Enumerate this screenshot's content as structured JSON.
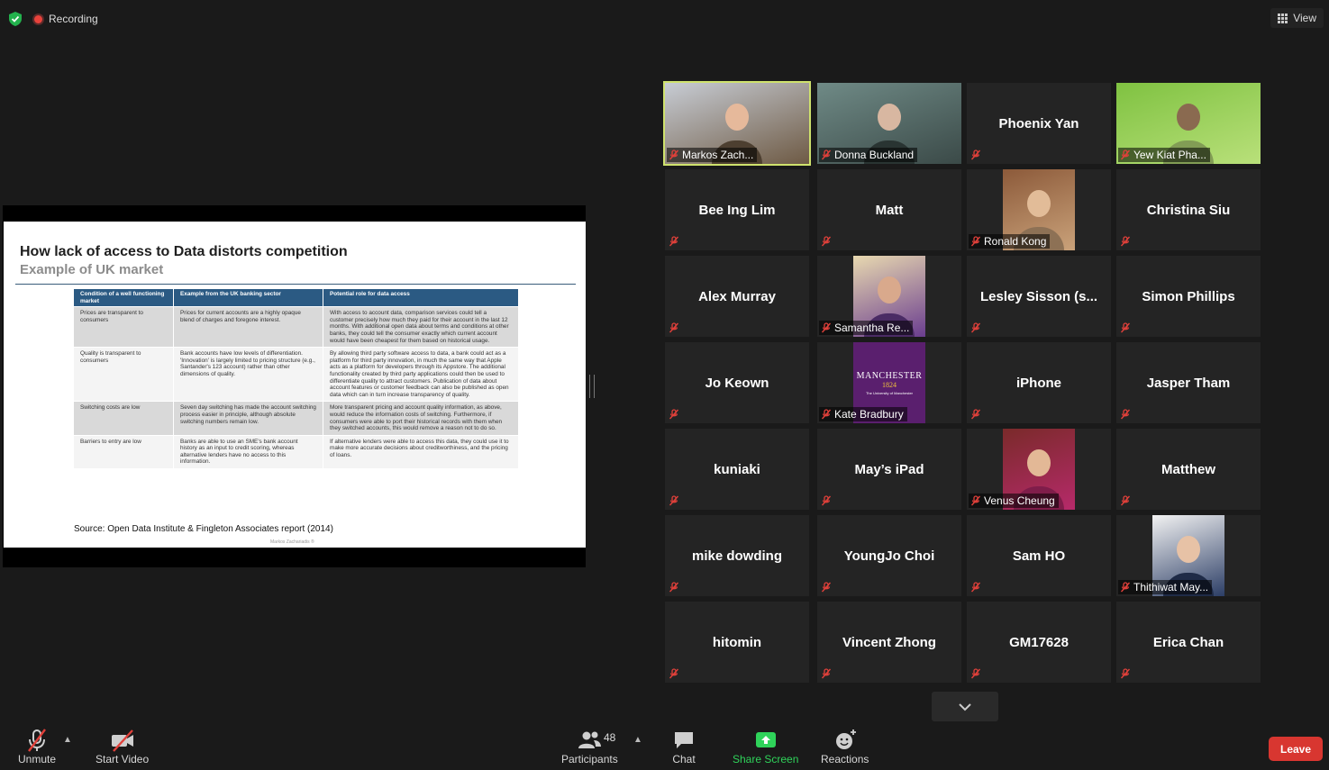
{
  "topbar": {
    "recording_label": "Recording",
    "view_label": "View"
  },
  "slide": {
    "title": "How lack of access to Data distorts competition",
    "subtitle": "Example of UK market",
    "headers": [
      "Condition of a well functioning market",
      "Example from the UK banking sector",
      "Potential role for data access"
    ],
    "rows": [
      [
        "Prices are transparent to consumers",
        "Prices for current accounts are a highly opaque blend of charges and foregone interest.",
        "With access to account data, comparison services could tell a customer precisely how much they paid for their account in the last 12 months. With additional open data about terms and conditions at other banks, they could tell the consumer exactly which current account would have been cheapest for them based on historical usage."
      ],
      [
        "Quality is transparent to consumers",
        "Bank accounts have low levels of differentiation. 'Innovation' is largely limited to pricing structure (e.g., Santander's 123 account) rather than other dimensions of quality.",
        "By allowing third party software access to data, a bank could act as a platform for third party innovation, in much the same way that Apple acts as a platform for developers through its Appstore. The additional functionality created by third party applications could then be used to differentiate quality to attract customers. Publication of data about account features or customer feedback can also be published as open data which can in turn increase transparency of quality."
      ],
      [
        "Switching costs are low",
        "Seven day switching has made the account switching process easier in principle, although absolute switching numbers remain low.",
        "More transparent pricing and account quality information, as above, would reduce the information costs of switching. Furthermore, if consumers were able to port their historical records with them when they switched accounts, this would remove a reason not to do so."
      ],
      [
        "Barriers to entry are low",
        "Banks are able to use an SME's bank account history as an input to credit scoring, whereas alternative lenders have no access to this information.",
        "If alternative lenders were able to access this data, they could use it to make more accurate decisions about creditworthiness, and the pricing of loans."
      ]
    ],
    "source": "Source: Open Data Institute & Fingleton Associates report (2014)",
    "footer": "Markos Zachariadis ®"
  },
  "participants": [
    {
      "name": "Markos Zach...",
      "video": true,
      "photo": "full",
      "palette": [
        "#c7ccd4",
        "#6e5a44",
        "#e6b99b"
      ],
      "active": true
    },
    {
      "name": "Donna Buckland",
      "video": true,
      "photo": "full",
      "palette": [
        "#6f8a86",
        "#3b4a48",
        "#d8b7a1"
      ]
    },
    {
      "name": "Phoenix Yan",
      "video": false
    },
    {
      "name": "Yew Kiat Pha...",
      "video": true,
      "photo": "full",
      "palette": [
        "#7fc241",
        "#b9e07a",
        "#8a6a50"
      ]
    },
    {
      "name": "Bee Ing Lim",
      "video": false
    },
    {
      "name": "Matt",
      "video": false
    },
    {
      "name": "Ronald Kong",
      "video": true,
      "photo": "center",
      "palette": [
        "#8c5a3a",
        "#caa27a",
        "#e2bc98"
      ]
    },
    {
      "name": "Christina Siu",
      "video": false
    },
    {
      "name": "Alex Murray",
      "video": false
    },
    {
      "name": "Samantha Re...",
      "video": true,
      "photo": "center",
      "palette": [
        "#e8d9b0",
        "#6a3d8f",
        "#d9a98c"
      ]
    },
    {
      "name": "Lesley Sisson (s...",
      "video": false
    },
    {
      "name": "Simon Phillips",
      "video": false
    },
    {
      "name": "Jo Keown",
      "video": false
    },
    {
      "name": "Kate Bradbury",
      "video": true,
      "photo": "center",
      "palette": [
        "#5a1f6e",
        "#5a1f6e",
        "#ffffff"
      ],
      "logo_text": "MANCHESTER",
      "logo_year": "1824",
      "logo_sub": "The University of Manchester"
    },
    {
      "name": "iPhone",
      "video": false
    },
    {
      "name": "Jasper Tham",
      "video": false
    },
    {
      "name": "kuniaki",
      "video": false
    },
    {
      "name": "May’s iPad",
      "video": false
    },
    {
      "name": "Venus Cheung",
      "video": true,
      "photo": "center",
      "palette": [
        "#7a2a2a",
        "#b62a6a",
        "#e3b896"
      ]
    },
    {
      "name": "Matthew",
      "video": false
    },
    {
      "name": "mike dowding",
      "video": false
    },
    {
      "name": "YoungJo Choi",
      "video": false
    },
    {
      "name": "Sam HO",
      "video": false
    },
    {
      "name": "Thithiwat May...",
      "video": true,
      "photo": "center",
      "palette": [
        "#f2f2f2",
        "#2c3e66",
        "#e7c2a6"
      ]
    },
    {
      "name": "hitomin",
      "video": false
    },
    {
      "name": "Vincent Zhong",
      "video": false
    },
    {
      "name": "GM17628",
      "video": false
    },
    {
      "name": "Erica Chan",
      "video": false
    }
  ],
  "toolbar": {
    "unmute_label": "Unmute",
    "start_video_label": "Start Video",
    "participants_label": "Participants",
    "participants_count": "48",
    "chat_label": "Chat",
    "share_screen_label": "Share Screen",
    "reactions_label": "Reactions",
    "leave_label": "Leave"
  },
  "colors": {
    "accent_green": "#2fd35a",
    "leave_red": "#d83630",
    "active_speaker": "#cfe26d",
    "mute_red": "#e0403a"
  }
}
